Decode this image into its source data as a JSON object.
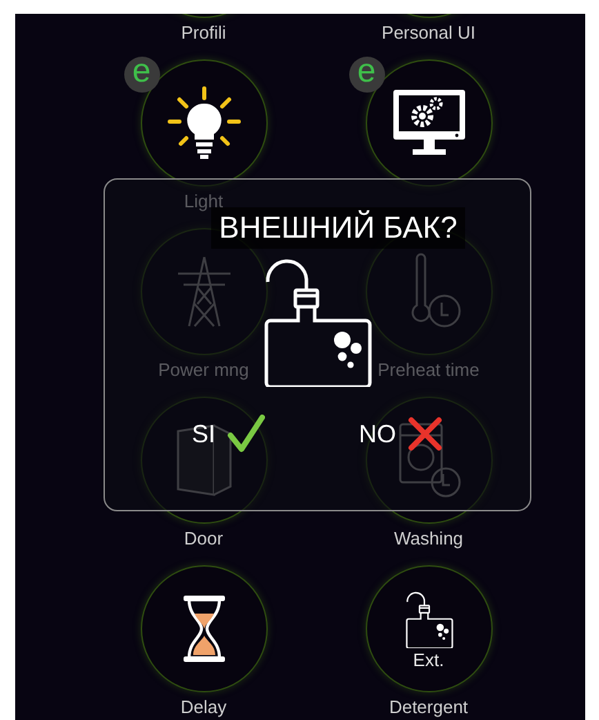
{
  "tiles": [
    {
      "label": "Profili",
      "kind": "none"
    },
    {
      "label": "Personal UI",
      "kind": "none"
    },
    {
      "label": "Light",
      "kind": "bulb",
      "badge": "e"
    },
    {
      "kind": "monitor",
      "badge": "e"
    },
    {
      "label": "Power mng",
      "kind": "tower"
    },
    {
      "label": "Preheat time",
      "kind": "thermometer"
    },
    {
      "label": "Door",
      "kind": "door"
    },
    {
      "label": "Washing",
      "kind": "washer"
    },
    {
      "label": "Delay",
      "kind": "hourglass"
    },
    {
      "label": "Detergent",
      "kind": "tank",
      "caption": "Ext."
    }
  ],
  "dialog": {
    "title": "ВНЕШНИЙ БАК?",
    "buttons": [
      {
        "label": "SI",
        "kind": "yes"
      },
      {
        "label": "NO",
        "kind": "no"
      }
    ]
  }
}
